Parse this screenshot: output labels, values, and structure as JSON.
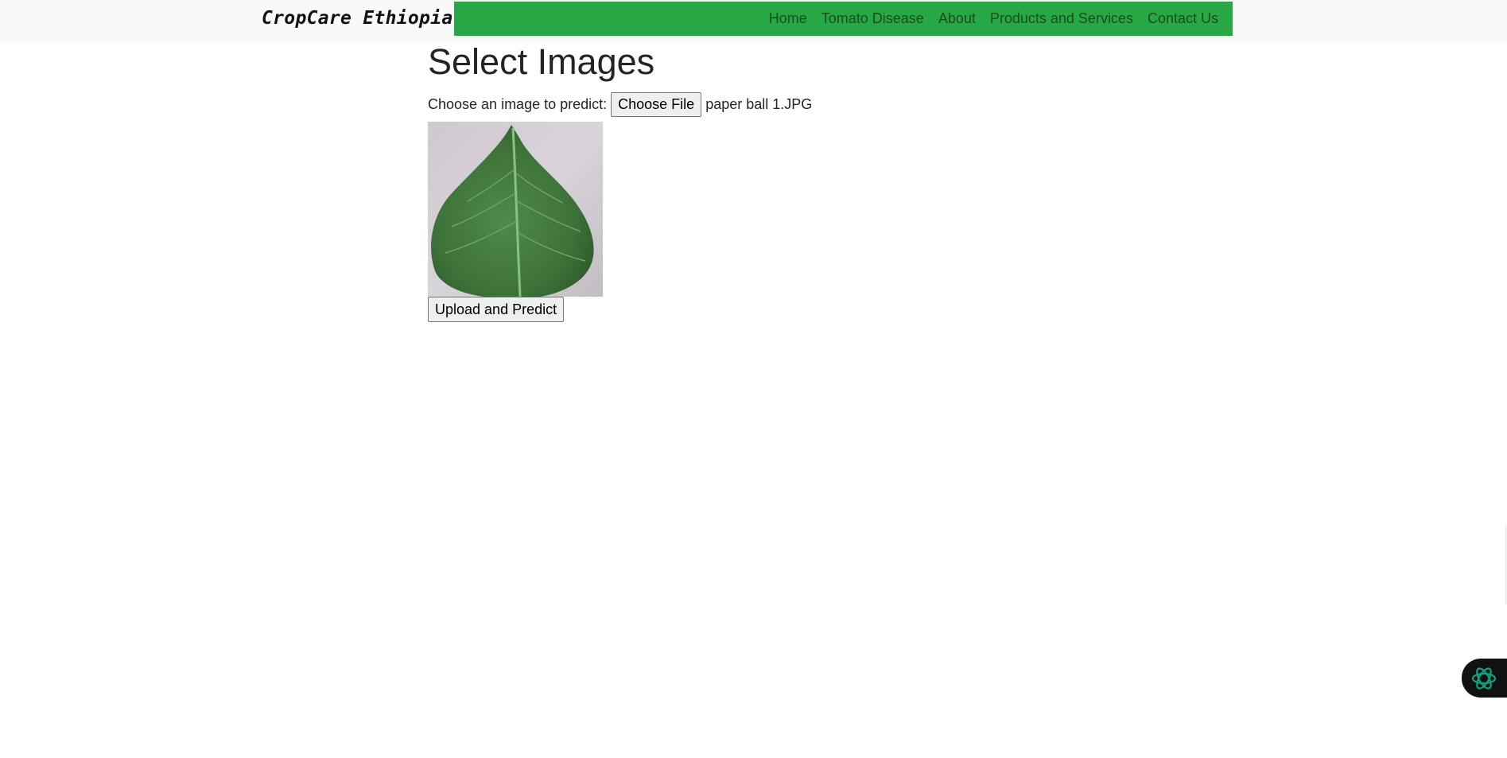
{
  "brand": "CropCare Ethiopia",
  "nav": [
    "Home",
    "Tomato Disease",
    "About",
    "Products and Services",
    "Contact Us"
  ],
  "colors": {
    "navband": "#28a745",
    "topbar": "#f8f9fa"
  },
  "page": {
    "title": "Select Images",
    "file_label": "Choose an image to predict:",
    "choose_button": "Choose File",
    "file_name": "paper ball 1.JPG",
    "preview_icon": "leaf-image",
    "upload_button": "Upload and Predict"
  },
  "assistant_icon": "openai-icon"
}
